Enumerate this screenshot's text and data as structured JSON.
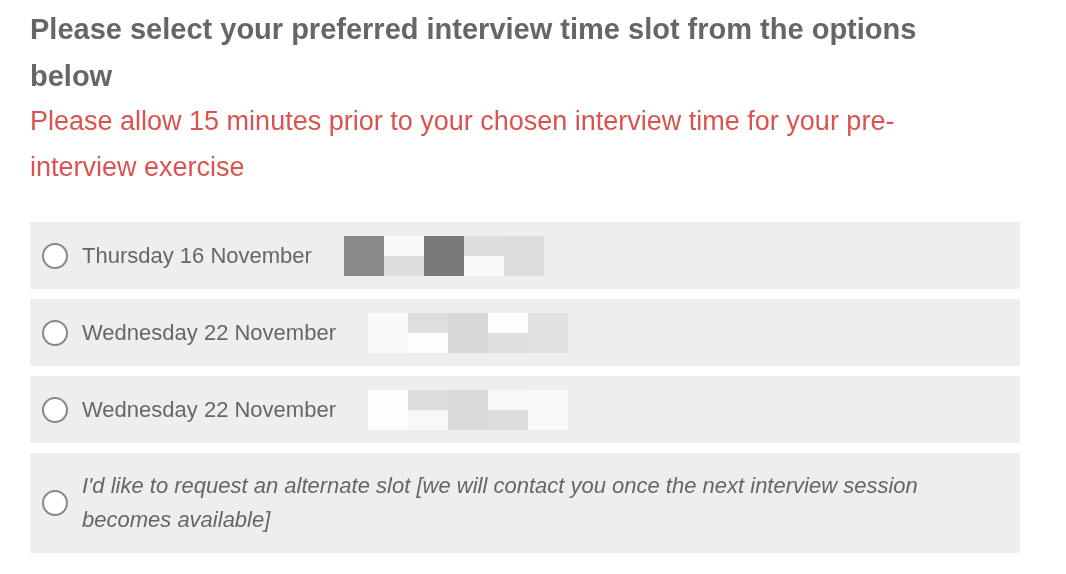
{
  "heading": "Please select your preferred interview time slot from the options below",
  "note": "Please allow 15 minutes prior to your chosen interview time for your pre-interview exercise",
  "options": [
    {
      "kind": "slot",
      "label": "Thursday 16 November",
      "selected": false
    },
    {
      "kind": "slot",
      "label": "Wednesday 22 November",
      "selected": false
    },
    {
      "kind": "slot",
      "label": "Wednesday 22 November",
      "selected": false
    },
    {
      "kind": "request",
      "label": "I'd like to request an alternate slot [we will contact you once the next interview session becomes available]",
      "selected": false
    }
  ]
}
